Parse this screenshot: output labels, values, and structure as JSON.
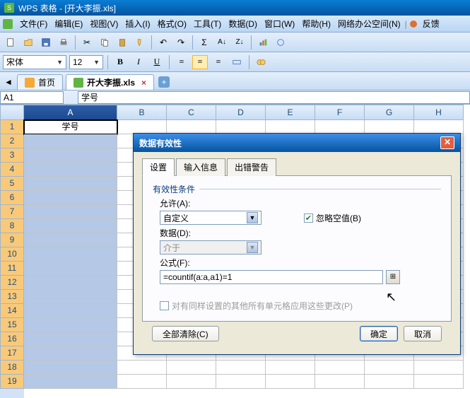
{
  "app": {
    "title": "WPS 表格 - [开大李振.xls]"
  },
  "menu": {
    "file": "文件(F)",
    "edit": "编辑(E)",
    "view": "视图(V)",
    "insert": "插入(I)",
    "format": "格式(O)",
    "tools": "工具(T)",
    "data": "数据(D)",
    "window": "窗口(W)",
    "help": "帮助(H)",
    "online": "网络办公空间(N)",
    "feedback": "反馈"
  },
  "formatbar": {
    "font": "宋体",
    "size": "12",
    "bold": "B",
    "italic": "I",
    "underline": "U"
  },
  "tabs": {
    "home": "首页",
    "doc": "开大李振.xls"
  },
  "namebox": {
    "ref": "A1",
    "formula": "学号"
  },
  "cols": {
    "a": "A",
    "b": "B",
    "c": "C",
    "d": "D",
    "e": "E",
    "f": "F",
    "g": "G",
    "h": "H"
  },
  "rows": {
    "r1": "1",
    "r2": "2",
    "r3": "3",
    "r4": "4",
    "r5": "5",
    "r6": "6",
    "r7": "7",
    "r8": "8",
    "r9": "9",
    "r10": "10",
    "r11": "11",
    "r12": "12",
    "r13": "13",
    "r14": "14",
    "r15": "15",
    "r16": "16",
    "r17": "17",
    "r18": "18",
    "r19": "19"
  },
  "cells": {
    "a1": "学号"
  },
  "dialog": {
    "title": "数据有效性",
    "tabs": {
      "settings": "设置",
      "input": "输入信息",
      "error": "出错警告"
    },
    "fieldset": "有效性条件",
    "allow_label": "允许(A):",
    "allow_value": "自定义",
    "ignore_blank": "忽略空值(B)",
    "data_label": "数据(D):",
    "data_value": "介于",
    "formula_label": "公式(F):",
    "formula_value": "=countif(a:a,a1)=1",
    "apply_all": "对有同样设置的其他所有单元格应用这些更改(P)",
    "clear_all": "全部清除(C)",
    "ok": "确定",
    "cancel": "取消"
  }
}
